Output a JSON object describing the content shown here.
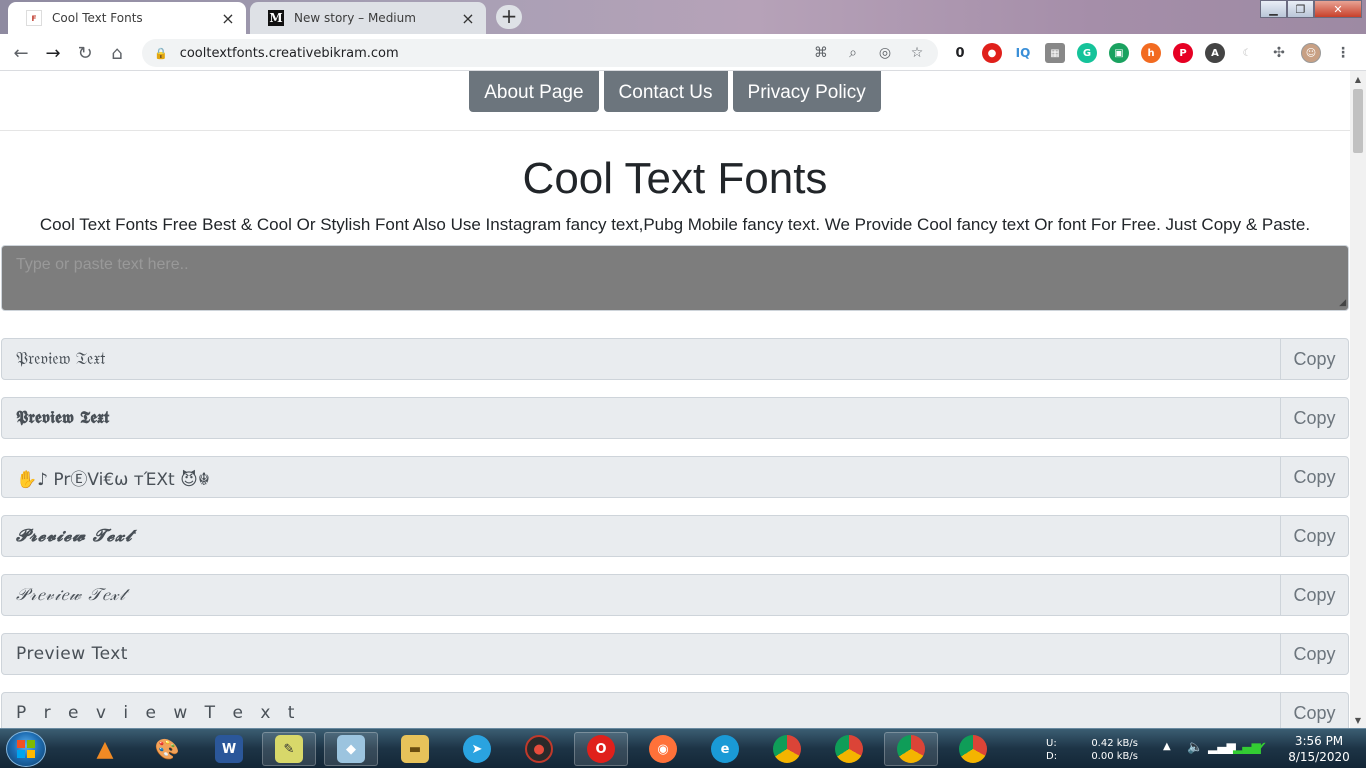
{
  "browser": {
    "tabs": [
      {
        "title": "Cool Text Fonts",
        "active": true,
        "favicon": "cool-fonts-favicon"
      },
      {
        "title": "New story – Medium",
        "active": false,
        "favicon": "medium-m-icon"
      }
    ],
    "new_tab_label": "+",
    "url": "cooltextfonts.creativebikram.com",
    "extension_badge": "0"
  },
  "page": {
    "nav": {
      "about": "About Page",
      "contact": "Contact Us",
      "privacy": "Privacy Policy"
    },
    "title": "Cool Text Fonts",
    "subtitle": "Cool Text Fonts Free Best & Cool Or Stylish Font Also Use Instagram fancy text,Pubg Mobile fancy text. We Provide Cool fancy text Or font For Free. Just Copy & Paste.",
    "input_placeholder": "Type or paste text here..",
    "copy_label": "Copy",
    "previews": [
      "𝔓𝔯𝔢𝔳𝔦𝔢𝔴 𝔗𝔢𝔵𝔱",
      "𝕻𝖗𝖊𝖛𝖎𝖊𝖜 𝕿𝖊𝖝𝖙",
      "✋♪ PrⒺVi€ω тΈXt 😈☬",
      "𝓟𝓻𝓮𝓿𝓲𝓮𝔀 𝓣𝓮𝔁𝓽",
      "𝒫𝓇𝑒𝓋𝒾𝑒𝓌 𝒯𝑒𝓍𝓉",
      "Preview Text",
      "P r e v i e w  T e x t"
    ]
  },
  "taskbar": {
    "net_up_label": "U:",
    "net_down_label": "D:",
    "net_up": "0.42 kB/s",
    "net_down": "0.00 kB/s",
    "time": "3:56 PM",
    "date": "8/15/2020"
  }
}
